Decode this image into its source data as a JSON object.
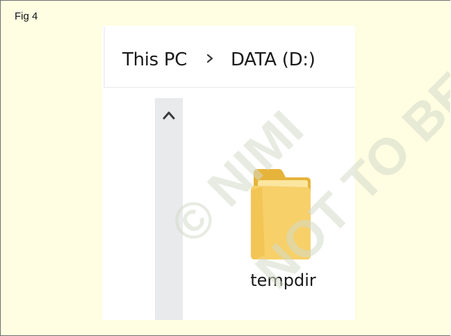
{
  "figure": {
    "label": "Fig 4"
  },
  "explorer": {
    "breadcrumb": {
      "items": [
        "This PC",
        "DATA (D:)"
      ],
      "separator_icon": "chevron-right-icon"
    },
    "scrollbar": {
      "up_icon": "chevron-up-icon"
    },
    "folder": {
      "name": "tempdir",
      "icon": "folder-icon"
    }
  },
  "watermark": {
    "lines": [
      "© NIMI",
      "NOT TO BE"
    ]
  },
  "colors": {
    "page_background": "#fffde2",
    "panel_border": "#6e6e6e",
    "scrollbar": "#e9eaec",
    "folder_front": "#f7d06a",
    "folder_back": "#e6b43a",
    "watermark": "#d4dac8"
  }
}
